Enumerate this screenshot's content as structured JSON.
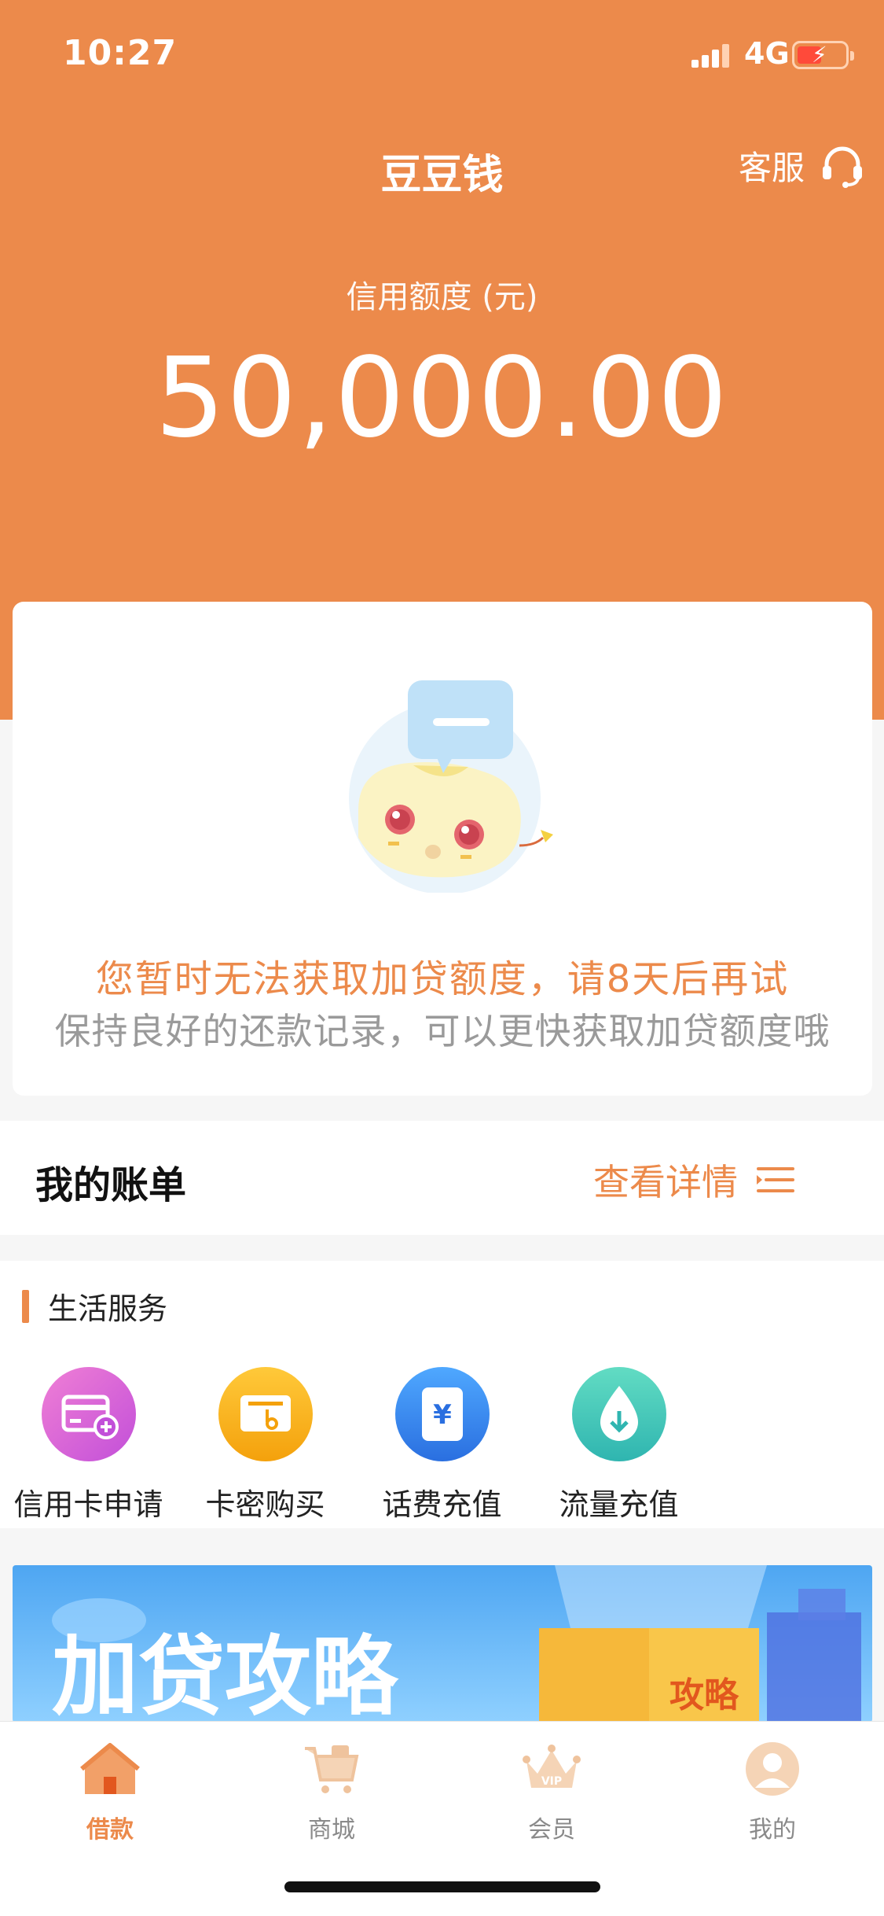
{
  "status_bar": {
    "time": "10:27",
    "network": "4G"
  },
  "header": {
    "title": "豆豆钱",
    "service_label": "客服"
  },
  "credit": {
    "label": "信用额度 (元)",
    "amount": "50,000.00"
  },
  "notice": {
    "primary": "您暂时无法获取加贷额度，请8天后再试",
    "secondary": "保持良好的还款记录，可以更快获取加贷额度哦"
  },
  "bill": {
    "title": "我的账单",
    "detail_label": "查看详情"
  },
  "life_services": {
    "title": "生活服务",
    "items": [
      {
        "label": "信用卡申请",
        "icon": "credit-card-add-icon",
        "color": "#d65ad9"
      },
      {
        "label": "卡密购买",
        "icon": "card-key-icon",
        "color": "#f7b21c"
      },
      {
        "label": "话费充值",
        "icon": "phone-bill-yuan-icon",
        "color": "#3e8ef0"
      },
      {
        "label": "流量充值",
        "icon": "data-drop-icon",
        "color": "#3ec9b8"
      }
    ]
  },
  "banner": {
    "title": "加贷攻略",
    "book_text": "攻略"
  },
  "tabs": [
    {
      "label": "借款",
      "icon": "home-icon",
      "active": true
    },
    {
      "label": "商城",
      "icon": "cart-icon",
      "active": false
    },
    {
      "label": "会员",
      "icon": "vip-crown-icon",
      "active": false
    },
    {
      "label": "我的",
      "icon": "profile-icon",
      "active": false
    }
  ],
  "colors": {
    "accent": "#ec8a4b",
    "muted_text": "#9a9a9a"
  }
}
